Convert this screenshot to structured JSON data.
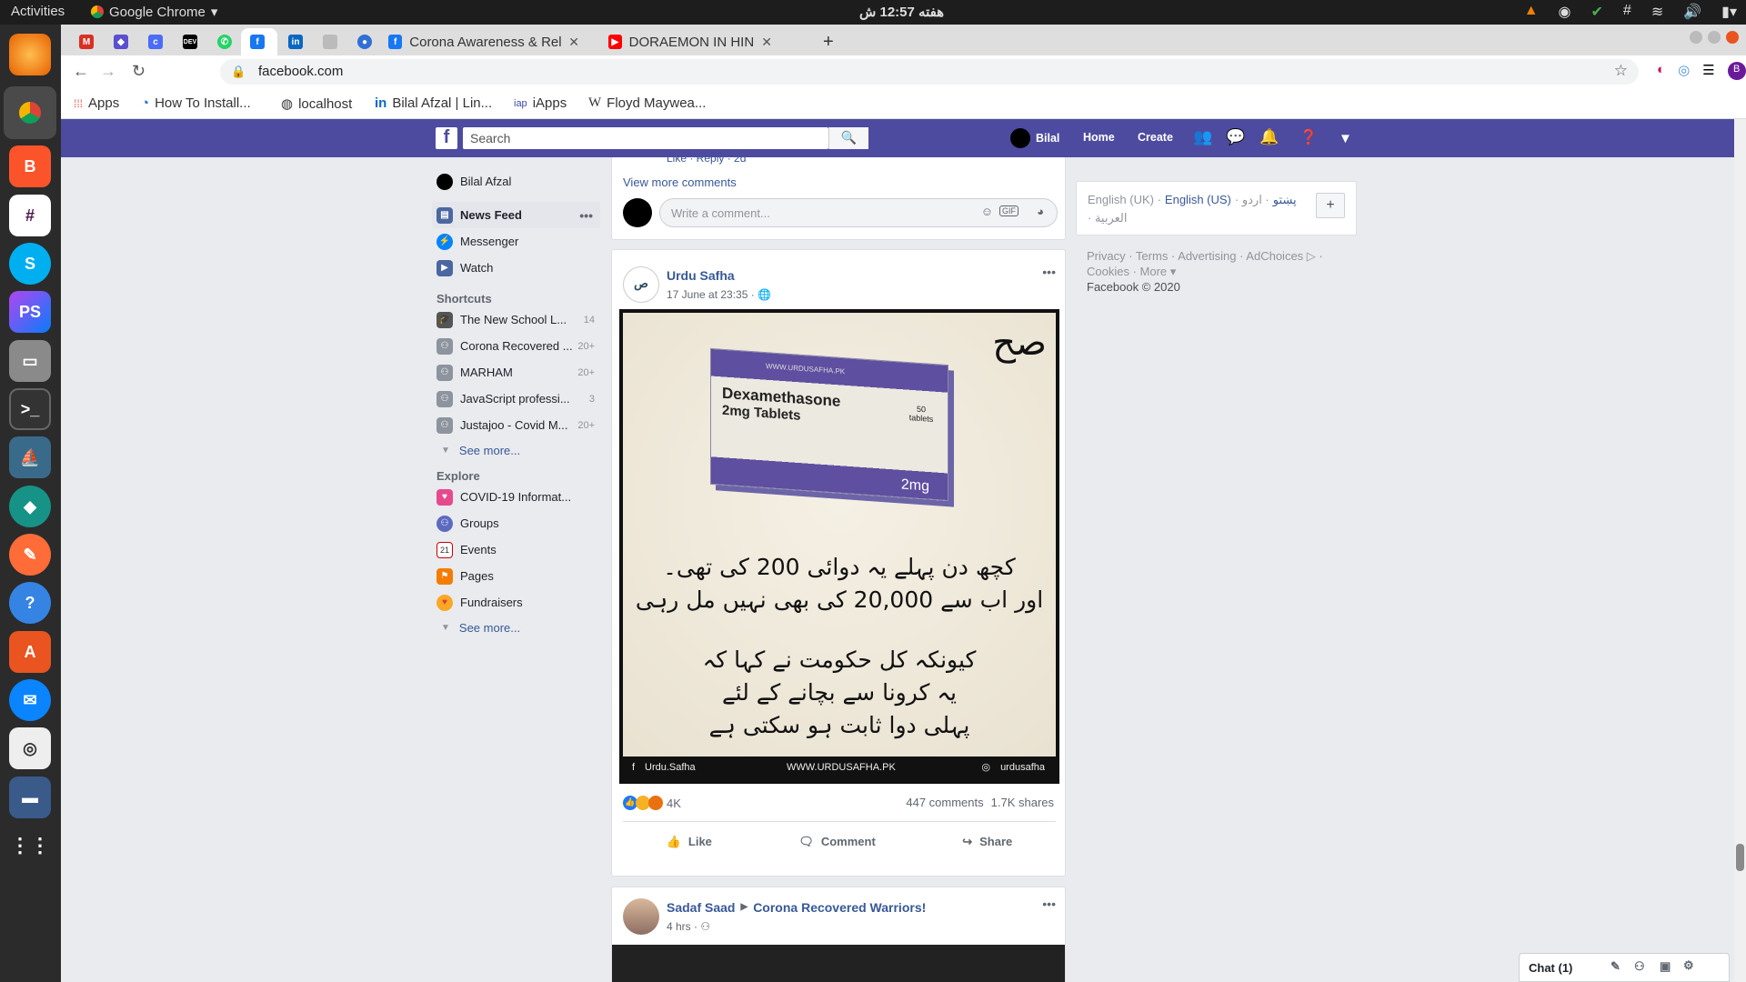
{
  "system": {
    "activities": "Activities",
    "app_name": "Google Chrome",
    "clock": "هفته 12:57 ش"
  },
  "tabs": [
    {
      "label": ""
    },
    {
      "label": ""
    },
    {
      "label": ""
    },
    {
      "label": "DEV"
    },
    {
      "label": ""
    },
    {
      "label": ""
    },
    {
      "label": ""
    },
    {
      "label": ""
    },
    {
      "label": ""
    },
    {
      "label": "Corona Awareness & Relie"
    },
    {
      "label": "DORAEMON IN HINDI NE"
    }
  ],
  "address": "facebook.com",
  "bookmarks": [
    "Apps",
    "How To Install...",
    "localhost",
    "Bilal Afzal | Lin...",
    "iApps",
    "Floyd Maywea..."
  ],
  "fb": {
    "search_placeholder": "Search",
    "nav_user": "Bilal",
    "nav_home": "Home",
    "nav_create": "Create"
  },
  "leftnav": {
    "user": "Bilal Afzal",
    "main": [
      {
        "label": "News Feed",
        "count": ""
      },
      {
        "label": "Messenger",
        "count": ""
      },
      {
        "label": "Watch",
        "count": ""
      }
    ],
    "shortcuts_title": "Shortcuts",
    "shortcuts": [
      {
        "label": "The New School L...",
        "count": "14"
      },
      {
        "label": "Corona Recovered ...",
        "count": "20+"
      },
      {
        "label": "MARHAM",
        "count": "20+"
      },
      {
        "label": "JavaScript professi...",
        "count": "3"
      },
      {
        "label": "Justajoo - Covid M...",
        "count": "20+"
      }
    ],
    "see_more": "See more...",
    "explore_title": "Explore",
    "explore": [
      {
        "label": "COVID-19 Informat..."
      },
      {
        "label": "Groups"
      },
      {
        "label": "Events"
      },
      {
        "label": "Pages"
      },
      {
        "label": "Fundraisers"
      }
    ]
  },
  "comments": {
    "reply_line": "Like · Reply · 2d",
    "view_more": "View more comments",
    "write_placeholder": "Write a comment..."
  },
  "post1": {
    "author": "Urdu Safha",
    "time": "17 June at 23:35 ·",
    "image": {
      "box_name": "Dexamethasone",
      "box_sub": "2mg Tablets",
      "box_dose": "2mg",
      "box_count": "50 tablets",
      "box_url": "WWW.URDUSAFHA.PK",
      "line1": "کچھ دن پہلے یہ دوائی 200 کی تھی۔",
      "line2": "اور اب سے 20,000 کی بھی نہیں مل رہی",
      "line3": "کیونکہ کل حکومت نے کہا کہ",
      "line4": "یہ کرونا سے بچانے کے لئے",
      "line5": "پہلی دوا ثابت ہو سکتی ہے",
      "footer_fb": "Urdu.Safha",
      "footer_url": "WWW.URDUSAFHA.PK",
      "footer_ig": "urdusafha"
    },
    "reactions": "4K",
    "comments": "447 comments",
    "shares": "1.7K shares",
    "like": "Like",
    "comment": "Comment",
    "share": "Share"
  },
  "post2": {
    "author": "Sadaf Saad",
    "group": "Corona Recovered Warriors!",
    "time": "4 hrs ·"
  },
  "right": {
    "lang_uk": "English (UK) ·",
    "lang_us": "English (US)",
    "lang_ur": "· اردو ·",
    "lang_ps": "پښتو",
    "lang_ar": "العربية ·",
    "footer_line1": "Privacy · Terms · Advertising · AdChoices ▷ ·",
    "footer_line2": "Cookies · More ▾",
    "copyright": "Facebook © 2020"
  },
  "chat": {
    "label": "Chat (1)"
  },
  "colors": {
    "fb_blue": "#4d4b9f",
    "link": "#385898"
  }
}
